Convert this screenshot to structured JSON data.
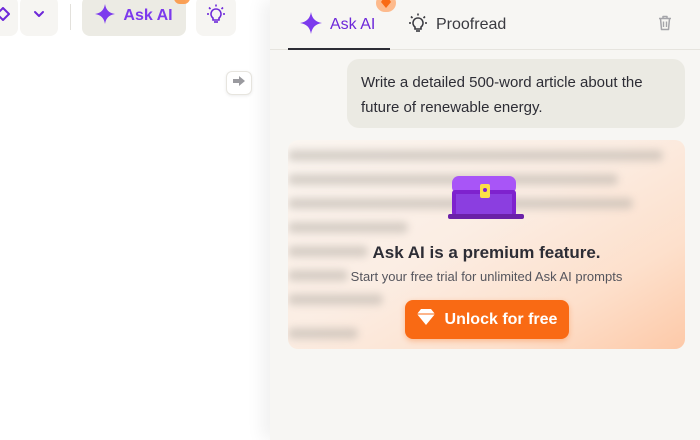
{
  "toolbar": {
    "ask_ai_label": "Ask AI",
    "icons": [
      "diamond-icon",
      "chevron-down-icon",
      "sparkle-icon",
      "lightbulb-icon"
    ]
  },
  "panel": {
    "tabs": [
      {
        "label": "Ask AI",
        "icon": "sparkle-icon",
        "active": true
      },
      {
        "label": "Proofread",
        "icon": "lightbulb-icon",
        "active": false
      }
    ],
    "prompt": "Write a detailed 500-word article about the future of renewable energy.",
    "premium": {
      "title": "Ask AI is a premium feature.",
      "subtitle": "Start your free trial for unlimited Ask AI prompts",
      "button_label": "Unlock for free"
    }
  },
  "colors": {
    "accent_purple": "#7c3aed",
    "cta_orange": "#f96a14",
    "panel_bg": "#f7f6f3"
  }
}
